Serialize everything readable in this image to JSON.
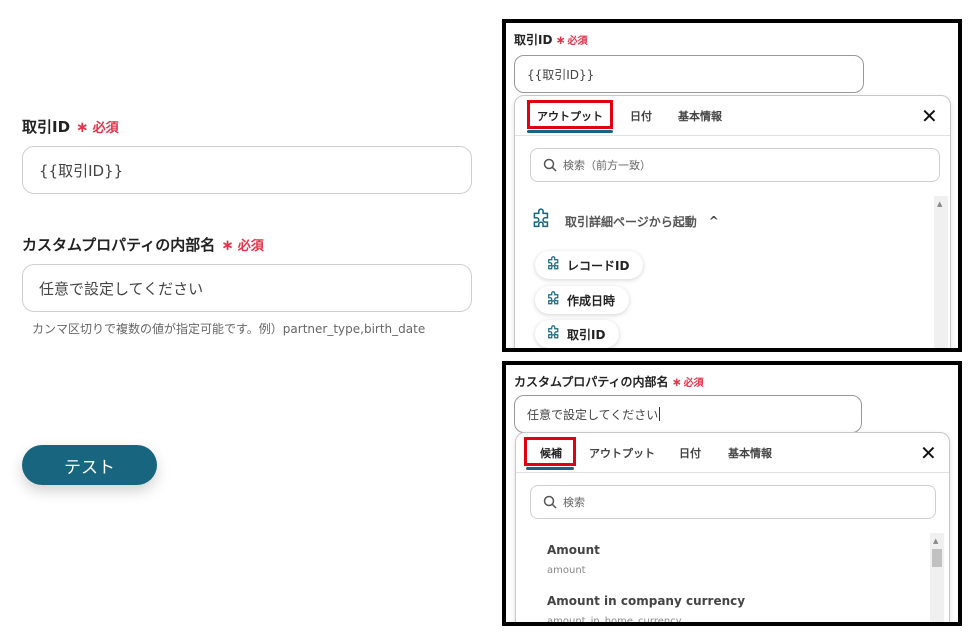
{
  "form": {
    "fields": [
      {
        "label": "取引ID",
        "required_star": "∗",
        "required_text": "必須",
        "value": "{{取引ID}}"
      },
      {
        "label": "カスタムプロパティの内部名",
        "required_star": "∗",
        "required_text": "必須",
        "placeholder": "任意で設定してください",
        "hint": "カンマ区切りで複数の値が指定可能です。例）partner_type,birth_date"
      }
    ],
    "test_button": "テスト"
  },
  "panel_top": {
    "label": "取引ID",
    "required_star": "∗",
    "required_text": "必須",
    "value": "{{取引ID}}",
    "tabs": [
      "アウトプット",
      "日付",
      "基本情報"
    ],
    "active_tab": "アウトプット",
    "search_placeholder": "検索（前方一致）",
    "group_title": "取引詳細ページから起動",
    "group_chevron": "^",
    "items": [
      "レコードID",
      "作成日時",
      "取引ID"
    ],
    "close": "✕"
  },
  "panel_bottom": {
    "label": "カスタムプロパティの内部名",
    "required_star": "∗",
    "required_text": "必須",
    "value": "任意で設定してください",
    "tabs": [
      "候補",
      "アウトプット",
      "日付",
      "基本情報"
    ],
    "active_tab": "候補",
    "search_placeholder": "検索",
    "candidates": [
      {
        "title": "Amount",
        "sub": "amount"
      },
      {
        "title": "Amount in company currency",
        "sub": "amount_in_home_currency"
      }
    ],
    "close": "✕"
  },
  "colors": {
    "accent": "#17657f",
    "required": "#e0344c",
    "highlight_box": "#e00012"
  },
  "icons": {
    "search": "search-icon",
    "puzzle": "puzzle-icon",
    "close": "close-icon",
    "chevron": "chevron-up-icon"
  }
}
